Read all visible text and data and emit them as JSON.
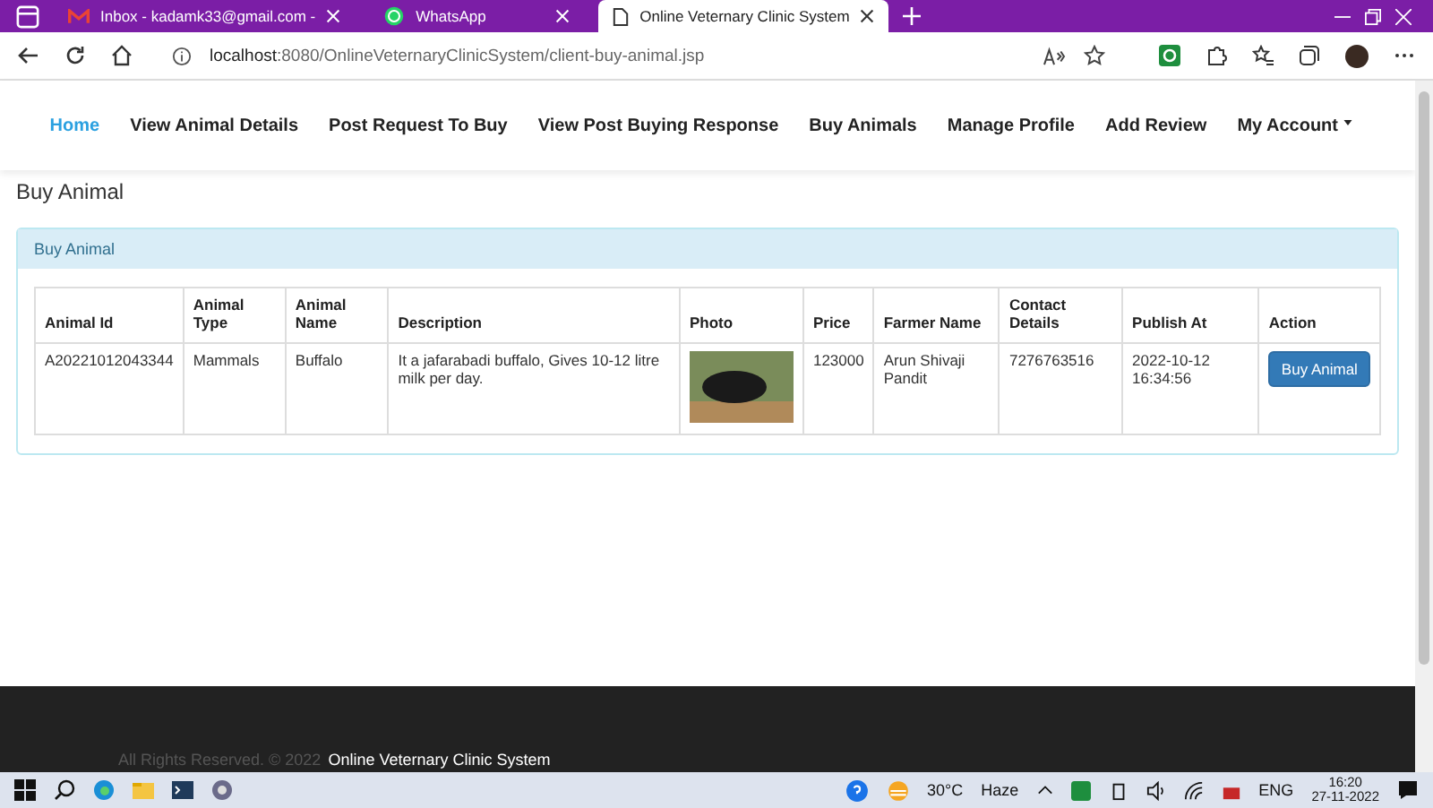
{
  "browser": {
    "tabs": [
      {
        "kind": "mail",
        "title": "Inbox - kadamk33@gmail.com -",
        "selected": false
      },
      {
        "kind": "chat",
        "title": "WhatsApp",
        "selected": false
      },
      {
        "kind": "page",
        "title": "Online Veternary Clinic System",
        "selected": true
      }
    ],
    "url_host": "localhost",
    "url_rest": ":8080/OnlineVeternaryClinicSystem/client-buy-animal.jsp"
  },
  "nav": {
    "items": [
      {
        "kind": "link",
        "label": "Home",
        "selected": true
      },
      {
        "kind": "link",
        "label": "View Animal Details",
        "selected": false
      },
      {
        "kind": "link",
        "label": "Post Request To Buy",
        "selected": false
      },
      {
        "kind": "link",
        "label": "View Post Buying Response",
        "selected": false
      },
      {
        "kind": "link",
        "label": "Buy Animals",
        "selected": false
      },
      {
        "kind": "link",
        "label": "Manage Profile",
        "selected": false
      },
      {
        "kind": "link",
        "label": "Add Review",
        "selected": false
      },
      {
        "kind": "dropdown",
        "label": "My Account",
        "selected": false
      }
    ]
  },
  "page_title": "Buy Animal",
  "panel": {
    "title": "Buy Animal",
    "table": {
      "columns": [
        "Animal Id",
        "Animal Type",
        "Animal Name",
        "Description",
        "Photo",
        "Price",
        "Farmer Name",
        "Contact Details",
        "Publish At",
        "Action"
      ],
      "rows": [
        {
          "cells": [
            {
              "kind": "text",
              "text": "A20221012043344"
            },
            {
              "kind": "text",
              "text": "Mammals"
            },
            {
              "kind": "text",
              "text": "Buffalo"
            },
            {
              "kind": "text",
              "text": "It a jafarabadi buffalo, Gives 10-12 litre milk per day."
            },
            {
              "kind": "photo"
            },
            {
              "kind": "text",
              "text": "123000"
            },
            {
              "kind": "text",
              "text": "Arun Shivaji Pandit"
            },
            {
              "kind": "text",
              "text": "7276763516"
            },
            {
              "kind": "text",
              "text": "2022-10-12 16:34:56"
            },
            {
              "kind": "button",
              "label": "Buy Animal"
            }
          ]
        }
      ]
    }
  },
  "footer": {
    "text": "All Rights Reserved. © 2022",
    "link": "Online Veternary Clinic System"
  },
  "taskbar": {
    "temperature": "30°C",
    "weather": "Haze",
    "language": "ENG",
    "time": "16:20",
    "date": "27-11-2022"
  }
}
